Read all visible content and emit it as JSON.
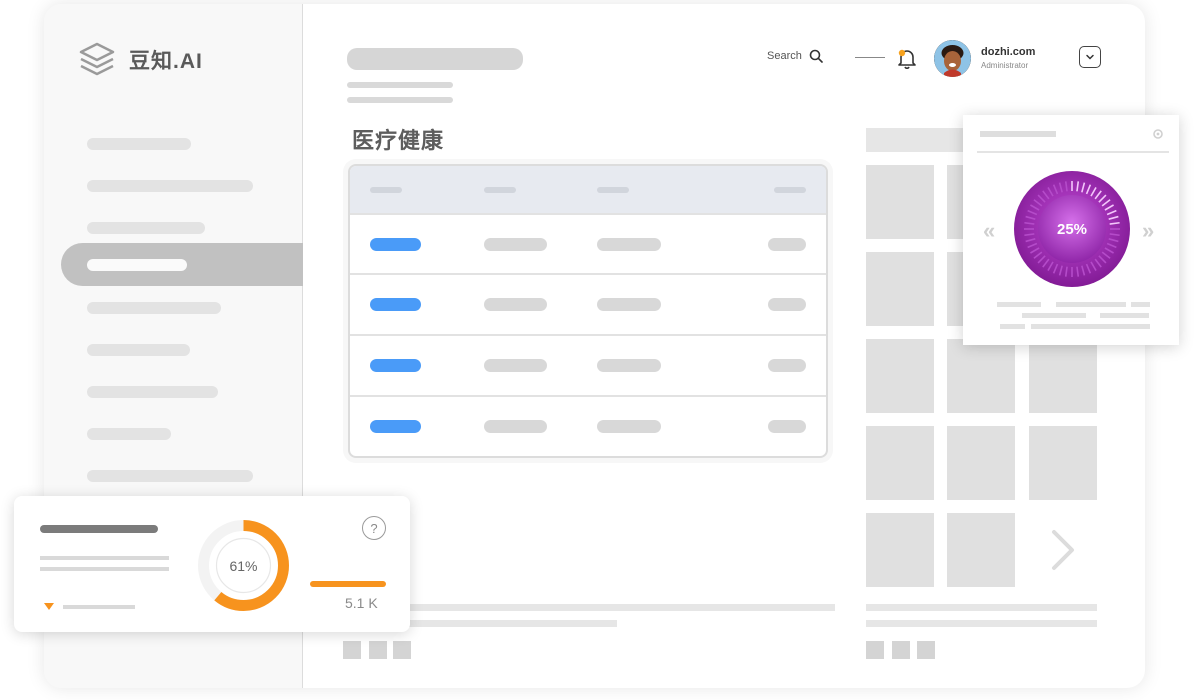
{
  "brand": {
    "name": "豆知.AI"
  },
  "header": {
    "search_label": "Search",
    "user": {
      "name": "dozhi.com",
      "role": "Administrator"
    }
  },
  "main": {
    "section_title": "医疗健康"
  },
  "gauge_card": {
    "value_label": "25%",
    "value": 0.25,
    "prev_icon": "«",
    "next_icon": "»",
    "accent": "#9b2fae"
  },
  "stat_card": {
    "percent_label": "61%",
    "percent": 0.61,
    "value_label": "5.1 K",
    "help_label": "?",
    "accent": "#f7931e"
  },
  "icons": [
    "stack-logo-icon",
    "search-icon",
    "bell-icon",
    "chevron-down-icon",
    "help-icon",
    "chevron-right-icon"
  ]
}
